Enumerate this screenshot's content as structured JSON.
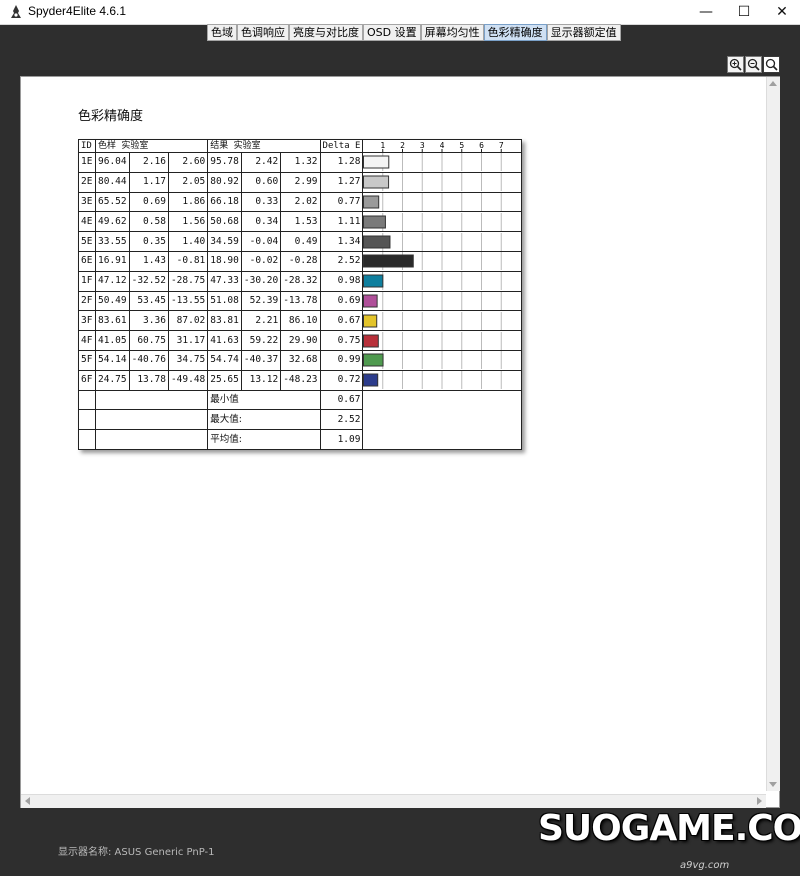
{
  "window": {
    "title": "Spyder4Elite 4.6.1"
  },
  "tabs": [
    {
      "label": "色域",
      "active": false
    },
    {
      "label": "色调响应",
      "active": false
    },
    {
      "label": "亮度与对比度",
      "active": false
    },
    {
      "label": "OSD 设置",
      "active": false
    },
    {
      "label": "屏幕均匀性",
      "active": false
    },
    {
      "label": "色彩精确度",
      "active": true
    },
    {
      "label": "显示器额定值",
      "active": false
    }
  ],
  "report": {
    "title": "色彩精确度",
    "headers": {
      "id": "ID",
      "sample": "色样 实验室",
      "result": "结果 实验室",
      "delta": "Delta E",
      "ticks": [
        "1",
        "2",
        "3",
        "4",
        "5",
        "6",
        "7"
      ]
    },
    "rows": [
      {
        "id": "1E",
        "s": [
          "96.04",
          "2.16",
          "2.60"
        ],
        "r": [
          "95.78",
          "2.42",
          "1.32"
        ],
        "de": "1.28"
      },
      {
        "id": "2E",
        "s": [
          "80.44",
          "1.17",
          "2.05"
        ],
        "r": [
          "80.92",
          "0.60",
          "2.99"
        ],
        "de": "1.27"
      },
      {
        "id": "3E",
        "s": [
          "65.52",
          "0.69",
          "1.86"
        ],
        "r": [
          "66.18",
          "0.33",
          "2.02"
        ],
        "de": "0.77"
      },
      {
        "id": "4E",
        "s": [
          "49.62",
          "0.58",
          "1.56"
        ],
        "r": [
          "50.68",
          "0.34",
          "1.53"
        ],
        "de": "1.11"
      },
      {
        "id": "5E",
        "s": [
          "33.55",
          "0.35",
          "1.40"
        ],
        "r": [
          "34.59",
          "-0.04",
          "0.49"
        ],
        "de": "1.34"
      },
      {
        "id": "6E",
        "s": [
          "16.91",
          "1.43",
          "-0.81"
        ],
        "r": [
          "18.90",
          "-0.02",
          "-0.28"
        ],
        "de": "2.52"
      },
      {
        "id": "1F",
        "s": [
          "47.12",
          "-32.52",
          "-28.75"
        ],
        "r": [
          "47.33",
          "-30.20",
          "-28.32"
        ],
        "de": "0.98"
      },
      {
        "id": "2F",
        "s": [
          "50.49",
          "53.45",
          "-13.55"
        ],
        "r": [
          "51.08",
          "52.39",
          "-13.78"
        ],
        "de": "0.69"
      },
      {
        "id": "3F",
        "s": [
          "83.61",
          "3.36",
          "87.02"
        ],
        "r": [
          "83.81",
          "2.21",
          "86.10"
        ],
        "de": "0.67"
      },
      {
        "id": "4F",
        "s": [
          "41.05",
          "60.75",
          "31.17"
        ],
        "r": [
          "41.63",
          "59.22",
          "29.90"
        ],
        "de": "0.75"
      },
      {
        "id": "5F",
        "s": [
          "54.14",
          "-40.76",
          "34.75"
        ],
        "r": [
          "54.74",
          "-40.37",
          "32.68"
        ],
        "de": "0.99"
      },
      {
        "id": "6F",
        "s": [
          "24.75",
          "13.78",
          "-49.48"
        ],
        "r": [
          "25.65",
          "13.12",
          "-48.23"
        ],
        "de": "0.72"
      }
    ],
    "summary": [
      {
        "label": "最小值",
        "value": "0.67"
      },
      {
        "label": "最大值:",
        "value": "2.52"
      },
      {
        "label": "平均值:",
        "value": "1.09"
      }
    ]
  },
  "chart_data": {
    "type": "bar",
    "orientation": "horizontal",
    "categories": [
      "1E",
      "2E",
      "3E",
      "4E",
      "5E",
      "6E",
      "1F",
      "2F",
      "3F",
      "4F",
      "5F",
      "6F"
    ],
    "values": [
      1.28,
      1.27,
      0.77,
      1.11,
      1.34,
      2.52,
      0.98,
      0.69,
      0.67,
      0.75,
      0.99,
      0.72
    ],
    "bar_colors": [
      "#f4f4f4",
      "#c8c8c8",
      "#9a9a9a",
      "#7a7a7a",
      "#555555",
      "#2a2a2a",
      "#0f7f9e",
      "#b0509a",
      "#e3c42a",
      "#b8303a",
      "#4f9a4f",
      "#2c3c8c"
    ],
    "xlim": [
      0,
      8
    ],
    "grid": true
  },
  "status": {
    "monitor_name": "显示器名称: ASUS Generic PnP-1"
  },
  "watermark": {
    "text": "SUOGAME.COM",
    "sub": "a9vg.com"
  }
}
